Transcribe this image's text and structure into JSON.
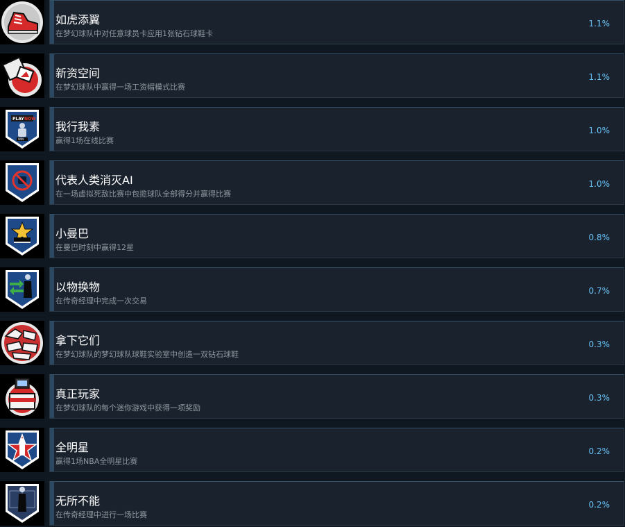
{
  "achievements": [
    {
      "name": "如虎添翼",
      "description": "在梦幻球队中对任意球员卡应用1张钻石球鞋卡",
      "percent": "1.1%",
      "icon": "red-sneaker-icon",
      "progress": 0.011
    },
    {
      "name": "新资空间",
      "description": "在梦幻球队中赢得一场工资帽模式比赛",
      "percent": "1.1%",
      "icon": "red-contract-card-icon",
      "progress": 0.011
    },
    {
      "name": "我行我素",
      "description": "赢得1场在线比赛",
      "percent": "1.0%",
      "icon": "play-now-player-badge-icon",
      "progress": 0.01
    },
    {
      "name": "代表人类消灭AI",
      "description": "在一场虚拟死敌比赛中包揽球队全部得分并赢得比赛",
      "percent": "1.0%",
      "icon": "no-ai-robot-badge-icon",
      "progress": 0.01
    },
    {
      "name": "小曼巴",
      "description": "在曼巴时刻中赢得12星",
      "percent": "0.8%",
      "icon": "star-shoe-badge-icon",
      "progress": 0.008
    },
    {
      "name": "以物换物",
      "description": "在传奇经理中完成一次交易",
      "percent": "0.7%",
      "icon": "trade-arrows-manager-badge-icon",
      "progress": 0.007
    },
    {
      "name": "拿下它们",
      "description": "在梦幻球队的梦幻球队球鞋实验室中创造一双钻石球鞋",
      "percent": "0.3%",
      "icon": "sneaker-pile-icon",
      "progress": 0.003
    },
    {
      "name": "真正玩家",
      "description": "在梦幻球队的每个迷你游戏中获得一项奖励",
      "percent": "0.3%",
      "icon": "arcade-machine-icon",
      "progress": 0.003
    },
    {
      "name": "全明星",
      "description": "赢得1场NBA全明星比赛",
      "percent": "0.2%",
      "icon": "nba-all-star-badge-icon",
      "progress": 0.002
    },
    {
      "name": "无所不能",
      "description": "在传奇经理中进行一场比赛",
      "percent": "0.2%",
      "icon": "manager-court-badge-icon",
      "progress": 0.002
    }
  ],
  "colors": {
    "background": "#0f1720",
    "card": "#1a222d",
    "card_border": "#2a3744",
    "progress_bar": "#2b4860",
    "percent_text": "#67c1f5",
    "title_text": "#ffffff",
    "description_text": "#8f98a0",
    "badge_blue": "#1e4a8a",
    "badge_red": "#d62a2a"
  }
}
